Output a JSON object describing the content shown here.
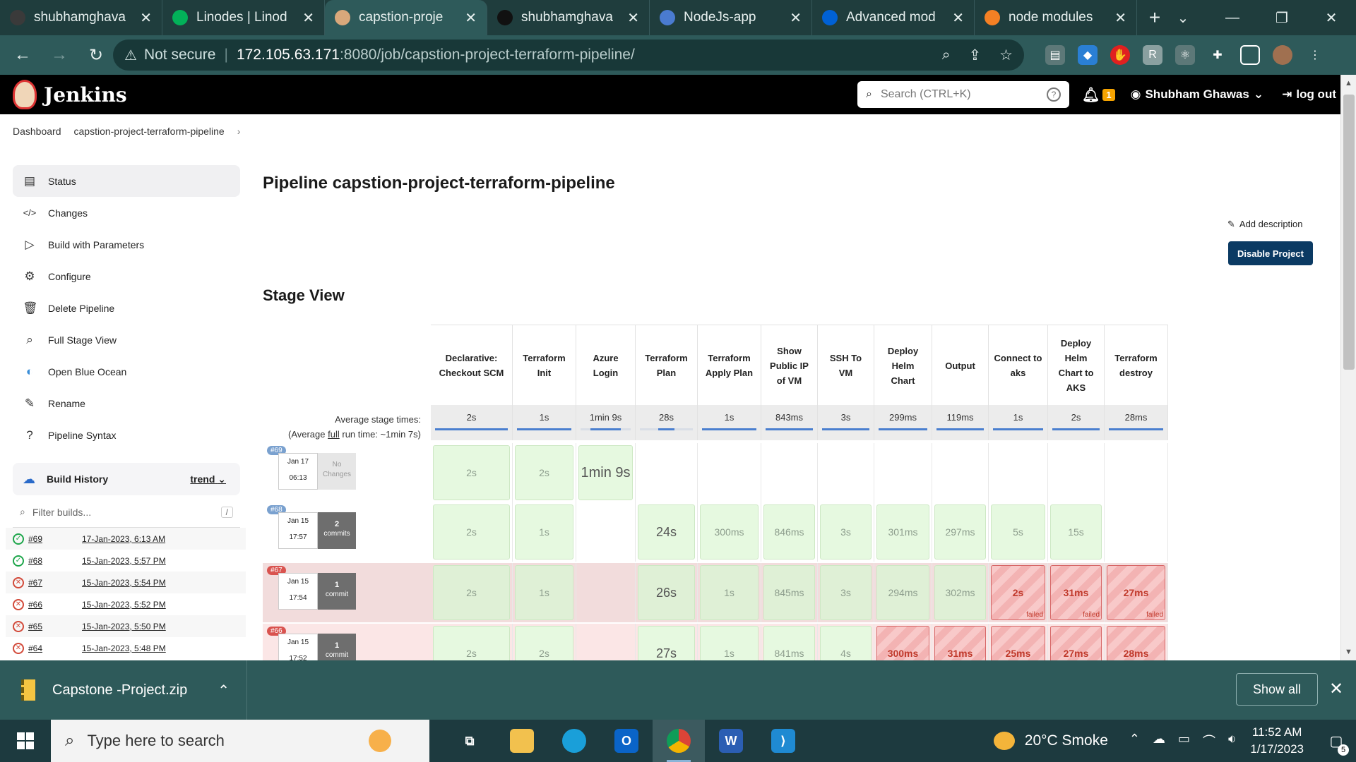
{
  "browser": {
    "tabs": [
      {
        "title": "shubhamghava",
        "favicon_color": "#3a3a3a",
        "active": false
      },
      {
        "title": "Linodes | Linod",
        "favicon_color": "#02b159",
        "active": false
      },
      {
        "title": "capstion-proje",
        "favicon_color": "#d9a87b",
        "active": true
      },
      {
        "title": "shubhamghava",
        "favicon_color": "#111111",
        "active": false
      },
      {
        "title": "NodeJs-app",
        "favicon_color": "#4a7bd0",
        "active": false
      },
      {
        "title": "Advanced mod",
        "favicon_color": "#0061d5",
        "active": false
      },
      {
        "title": "node modules",
        "favicon_color": "#f48024",
        "active": false
      }
    ],
    "address": {
      "security": "Not secure",
      "separator": "|",
      "host": "172.105.63.171",
      "path": ":8080/job/capstion-project-terraform-pipeline/"
    }
  },
  "jenkins": {
    "brand": "Jenkins",
    "search_placeholder": "Search (CTRL+K)",
    "notifications": "1",
    "user": "Shubham Ghawas",
    "logout": "log out",
    "breadcrumb": [
      "Dashboard",
      "capstion-project-terraform-pipeline"
    ],
    "sidebar": [
      {
        "label": "Status",
        "icon": "status-icon",
        "active": true
      },
      {
        "label": "Changes",
        "icon": "code-icon",
        "active": false
      },
      {
        "label": "Build with Parameters",
        "icon": "play-icon",
        "active": false
      },
      {
        "label": "Configure",
        "icon": "gear-icon",
        "active": false
      },
      {
        "label": "Delete Pipeline",
        "icon": "trash-icon",
        "active": false
      },
      {
        "label": "Full Stage View",
        "icon": "search-icon",
        "active": false
      },
      {
        "label": "Open Blue Ocean",
        "icon": "blue-ocean-icon",
        "active": false
      },
      {
        "label": "Rename",
        "icon": "pencil-icon",
        "active": false
      },
      {
        "label": "Pipeline Syntax",
        "icon": "help-icon",
        "active": false
      }
    ],
    "build_history": {
      "title": "Build History",
      "trend": "trend",
      "filter_placeholder": "Filter builds...",
      "filter_shortcut": "/",
      "builds": [
        {
          "id": "#69",
          "date": "17-Jan-2023, 6:13 AM",
          "status": "success"
        },
        {
          "id": "#68",
          "date": "15-Jan-2023, 5:57 PM",
          "status": "success"
        },
        {
          "id": "#67",
          "date": "15-Jan-2023, 5:54 PM",
          "status": "failed"
        },
        {
          "id": "#66",
          "date": "15-Jan-2023, 5:52 PM",
          "status": "failed"
        },
        {
          "id": "#65",
          "date": "15-Jan-2023, 5:50 PM",
          "status": "failed"
        },
        {
          "id": "#64",
          "date": "15-Jan-2023, 5:48 PM",
          "status": "failed"
        }
      ]
    },
    "page_title": "Pipeline capstion-project-terraform-pipeline",
    "add_description": "Add description",
    "disable_project": "Disable Project",
    "stage_view_title": "Stage View",
    "avg_stage_label": "Average stage times:",
    "avg_full_prefix": "(Average ",
    "avg_full_word": "full",
    "avg_full_suffix": " run time: ~1min 7s)",
    "stages": [
      {
        "name": "Declarative: Checkout SCM",
        "avg": "2s",
        "progress": 1.0
      },
      {
        "name": "Terraform Init",
        "avg": "1s",
        "progress": 1.0
      },
      {
        "name": "Azure Login",
        "avg": "1min 9s",
        "progress": 0.6
      },
      {
        "name": "Terraform Plan",
        "avg": "28s",
        "progress": 0.3
      },
      {
        "name": "Terraform Apply Plan",
        "avg": "1s",
        "progress": 1.0
      },
      {
        "name": "Show Public IP of VM",
        "avg": "843ms",
        "progress": 1.0
      },
      {
        "name": "SSH To VM",
        "avg": "3s",
        "progress": 1.0
      },
      {
        "name": "Deploy Helm Chart",
        "avg": "299ms",
        "progress": 1.0
      },
      {
        "name": "Output",
        "avg": "119ms",
        "progress": 1.0
      },
      {
        "name": "Connect to aks",
        "avg": "1s",
        "progress": 1.0
      },
      {
        "name": "Deploy Helm Chart to AKS",
        "avg": "2s",
        "progress": 1.0
      },
      {
        "name": "Terraform destroy",
        "avg": "28ms",
        "progress": 1.0
      }
    ],
    "runs": [
      {
        "id": "#69",
        "month_day": "Jan 17",
        "time": "06:13",
        "changes": "No Changes",
        "changes_n": "",
        "cells": [
          "2s",
          "2s",
          "1min 9s",
          "",
          "",
          "",
          "",
          "",
          "",
          "",
          "",
          ""
        ],
        "states": [
          "ok",
          "ok",
          "ok",
          "",
          "",
          "",
          "",
          "",
          "",
          "",
          "",
          ""
        ]
      },
      {
        "id": "#68",
        "month_day": "Jan 15",
        "time": "17:57",
        "changes": "commits",
        "changes_n": "2",
        "cells": [
          "2s",
          "1s",
          "",
          "24s",
          "300ms",
          "846ms",
          "3s",
          "301ms",
          "297ms",
          "5s",
          "15s",
          ""
        ],
        "states": [
          "ok",
          "ok",
          "",
          "ok",
          "ok",
          "ok",
          "ok",
          "ok",
          "ok",
          "ok",
          "ok",
          ""
        ]
      },
      {
        "id": "#67",
        "month_day": "Jan 15",
        "time": "17:54",
        "changes": "commit",
        "changes_n": "1",
        "cells": [
          "2s",
          "1s",
          "",
          "26s",
          "1s",
          "845ms",
          "3s",
          "294ms",
          "302ms",
          "2s",
          "31ms",
          "27ms"
        ],
        "states": [
          "ok",
          "ok",
          "",
          "ok",
          "ok",
          "ok",
          "ok",
          "ok",
          "ok",
          "fail",
          "fail",
          "fail"
        ]
      },
      {
        "id": "#66",
        "month_day": "Jan 15",
        "time": "17:52",
        "changes": "commit",
        "changes_n": "1",
        "cells": [
          "2s",
          "2s",
          "",
          "27s",
          "1s",
          "841ms",
          "4s",
          "300ms",
          "31ms",
          "25ms",
          "27ms",
          "28ms"
        ],
        "states": [
          "ok",
          "ok",
          "",
          "ok",
          "ok",
          "ok",
          "ok",
          "fail",
          "fail",
          "fail",
          "fail",
          "fail"
        ]
      }
    ],
    "failed_tag": "failed"
  },
  "downloads": {
    "file": "Capstone -Project.zip",
    "show_all": "Show all"
  },
  "taskbar": {
    "search_placeholder": "Type here to search",
    "weather": "20°C  Smoke",
    "time": "11:52 AM",
    "date": "1/17/2023",
    "notifications": "5"
  }
}
